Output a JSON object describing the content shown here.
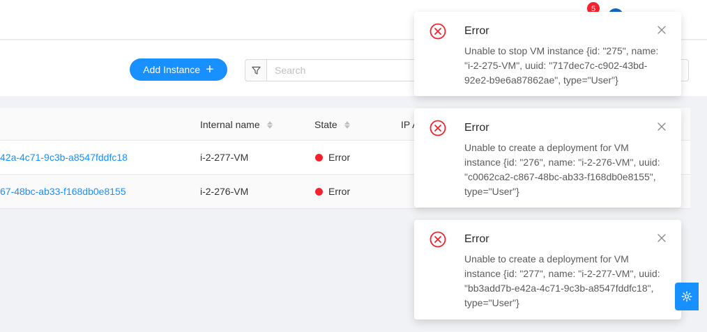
{
  "header": {
    "notification_count": "5"
  },
  "toolbar": {
    "add_label": "Add Instance",
    "search_placeholder": "Search"
  },
  "table": {
    "columns": [
      "Internal name",
      "State",
      "IP A"
    ],
    "rows": [
      {
        "uuid": "42a-4c71-9c3b-a8547fddfc18",
        "internal_name": "i-2-277-VM",
        "state": "Error"
      },
      {
        "uuid": "67-48bc-ab33-f168db0e8155",
        "internal_name": "i-2-276-VM",
        "state": "Error"
      }
    ]
  },
  "notifications": [
    {
      "title": "Error",
      "message": "Unable to stop VM instance {id: \"275\", name: \"i-2-275-VM\", uuid: \"717dec7c-c902-43bd-92e2-b9e6a87862ae\", type=\"User\"}"
    },
    {
      "title": "Error",
      "message": "Unable to create a deployment for VM instance {id: \"276\", name: \"i-2-276-VM\", uuid: \"c0062ca2-c867-48bc-ab33-f168db0e8155\", type=\"User\"}"
    },
    {
      "title": "Error",
      "message": "Unable to create a deployment for VM instance {id: \"277\", name: \"i-2-277-VM\", uuid: \"bb3add7b-e42a-4c71-9c3b-a8547fddfc18\", type=\"User\"}"
    }
  ],
  "colors": {
    "primary": "#1890ff",
    "error": "#f5222d"
  },
  "icons": {
    "filter": "filter-icon",
    "error": "close-circle-icon",
    "close": "close-icon",
    "settings": "gear-icon"
  }
}
